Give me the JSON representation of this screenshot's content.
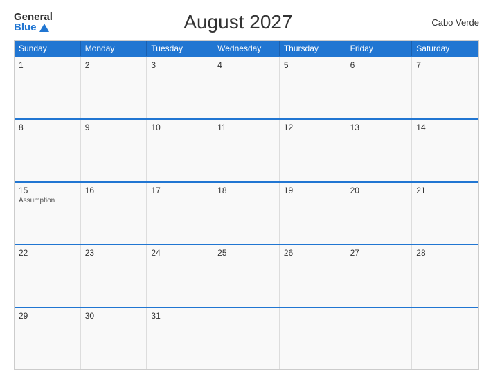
{
  "logo": {
    "general": "General",
    "blue": "Blue"
  },
  "title": "August 2027",
  "country": "Cabo Verde",
  "dayHeaders": [
    "Sunday",
    "Monday",
    "Tuesday",
    "Wednesday",
    "Thursday",
    "Friday",
    "Saturday"
  ],
  "weeks": [
    [
      {
        "day": "1",
        "holiday": ""
      },
      {
        "day": "2",
        "holiday": ""
      },
      {
        "day": "3",
        "holiday": ""
      },
      {
        "day": "4",
        "holiday": ""
      },
      {
        "day": "5",
        "holiday": ""
      },
      {
        "day": "6",
        "holiday": ""
      },
      {
        "day": "7",
        "holiday": ""
      }
    ],
    [
      {
        "day": "8",
        "holiday": ""
      },
      {
        "day": "9",
        "holiday": ""
      },
      {
        "day": "10",
        "holiday": ""
      },
      {
        "day": "11",
        "holiday": ""
      },
      {
        "day": "12",
        "holiday": ""
      },
      {
        "day": "13",
        "holiday": ""
      },
      {
        "day": "14",
        "holiday": ""
      }
    ],
    [
      {
        "day": "15",
        "holiday": "Assumption"
      },
      {
        "day": "16",
        "holiday": ""
      },
      {
        "day": "17",
        "holiday": ""
      },
      {
        "day": "18",
        "holiday": ""
      },
      {
        "day": "19",
        "holiday": ""
      },
      {
        "day": "20",
        "holiday": ""
      },
      {
        "day": "21",
        "holiday": ""
      }
    ],
    [
      {
        "day": "22",
        "holiday": ""
      },
      {
        "day": "23",
        "holiday": ""
      },
      {
        "day": "24",
        "holiday": ""
      },
      {
        "day": "25",
        "holiday": ""
      },
      {
        "day": "26",
        "holiday": ""
      },
      {
        "day": "27",
        "holiday": ""
      },
      {
        "day": "28",
        "holiday": ""
      }
    ],
    [
      {
        "day": "29",
        "holiday": ""
      },
      {
        "day": "30",
        "holiday": ""
      },
      {
        "day": "31",
        "holiday": ""
      },
      {
        "day": "",
        "holiday": ""
      },
      {
        "day": "",
        "holiday": ""
      },
      {
        "day": "",
        "holiday": ""
      },
      {
        "day": "",
        "holiday": ""
      }
    ]
  ]
}
